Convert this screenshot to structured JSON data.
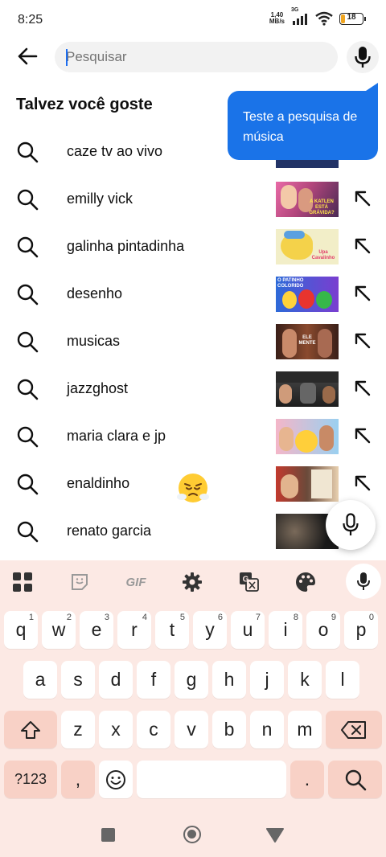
{
  "status_bar": {
    "time": "8:25",
    "net_speed_value": "1,40",
    "net_speed_unit": "MB/s",
    "network_type": "3G",
    "battery": "18"
  },
  "search": {
    "placeholder": "Pesquisar"
  },
  "section_title": "Talvez você goste",
  "tooltip": {
    "text": "Teste a pesquisa de música"
  },
  "suggestions": [
    {
      "label": "caze tv ao vivo",
      "icon": "search-icon"
    },
    {
      "label": "emilly vick",
      "icon": "search-icon",
      "thumb_caption": "A KATLEN ESTÁ GRÁVIDA?"
    },
    {
      "label": "galinha pintadinha",
      "icon": "search-icon",
      "thumb_caption": "Upa Cavalinho"
    },
    {
      "label": "desenho",
      "icon": "search-icon",
      "thumb_caption": "O PATINHO COLORIDO"
    },
    {
      "label": "musicas",
      "icon": "search-icon",
      "thumb_caption": "ELE MENTE"
    },
    {
      "label": "jazzghost",
      "icon": "search-icon"
    },
    {
      "label": "maria clara e jp",
      "icon": "search-icon"
    },
    {
      "label": "enaldinho",
      "icon": "search-icon"
    },
    {
      "label": "renato garcia",
      "icon": "search-icon"
    }
  ],
  "keyboard": {
    "toolbar": {
      "gif_label": "GIF"
    },
    "row1": [
      {
        "key": "q",
        "hint": "1"
      },
      {
        "key": "w",
        "hint": "2"
      },
      {
        "key": "e",
        "hint": "3"
      },
      {
        "key": "r",
        "hint": "4"
      },
      {
        "key": "t",
        "hint": "5"
      },
      {
        "key": "y",
        "hint": "6"
      },
      {
        "key": "u",
        "hint": "7"
      },
      {
        "key": "i",
        "hint": "8"
      },
      {
        "key": "o",
        "hint": "9"
      },
      {
        "key": "p",
        "hint": "0"
      }
    ],
    "row2": [
      "a",
      "s",
      "d",
      "f",
      "g",
      "h",
      "j",
      "k",
      "l"
    ],
    "row3": [
      "z",
      "x",
      "c",
      "v",
      "b",
      "n",
      "m"
    ],
    "symbols_label": "?123",
    "comma_label": ",",
    "period_label": "."
  },
  "colors": {
    "accent": "#1a73e8",
    "keyboard_bg": "#fce9e4",
    "special_key": "#f8d1c6"
  }
}
